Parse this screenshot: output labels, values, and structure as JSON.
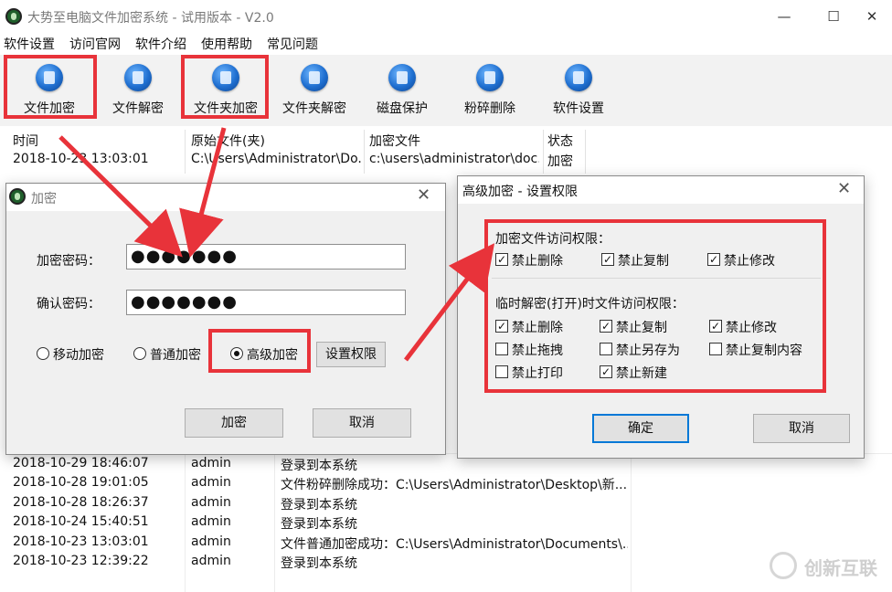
{
  "window": {
    "title": "大势至电脑文件加密系统 - 试用版本 - V2.0",
    "minimize": "—",
    "maximize": "☐",
    "close": "✕"
  },
  "menu": [
    "软件设置",
    "访问官网",
    "软件介绍",
    "使用帮助",
    "常见问题"
  ],
  "toolbar": [
    {
      "label": "文件加密",
      "icon": "file-lock-icon"
    },
    {
      "label": "文件解密",
      "icon": "file-unlock-icon"
    },
    {
      "label": "文件夹加密",
      "icon": "folder-lock-icon"
    },
    {
      "label": "文件夹解密",
      "icon": "folder-unlock-icon"
    },
    {
      "label": "磁盘保护",
      "icon": "disk-shield-icon"
    },
    {
      "label": "粉碎删除",
      "icon": "shred-icon"
    },
    {
      "label": "软件设置",
      "icon": "gear-icon"
    }
  ],
  "table": {
    "columns": [
      "时间",
      "原始文件(夹)",
      "加密文件",
      "状态"
    ],
    "rows": [
      {
        "time": "2018-10-23 13:03:01",
        "original": "C:\\Users\\Administrator\\Do...",
        "encrypted": "c:\\users\\administrator\\doc...",
        "status": "加密"
      }
    ]
  },
  "log": {
    "rows": [
      {
        "time": "2018-10-29 18:46:07",
        "user": "admin",
        "event": "登录到本系统"
      },
      {
        "time": "2018-10-28 19:01:05",
        "user": "admin",
        "event": "文件粉碎删除成功：C:\\Users\\Administrator\\Desktop\\新..."
      },
      {
        "time": "2018-10-28 18:26:37",
        "user": "admin",
        "event": "登录到本系统"
      },
      {
        "time": "2018-10-24 15:40:51",
        "user": "admin",
        "event": "登录到本系统"
      },
      {
        "time": "2018-10-23 13:03:01",
        "user": "admin",
        "event": "文件普通加密成功：C:\\Users\\Administrator\\Documents\\..."
      },
      {
        "time": "2018-10-23 12:39:22",
        "user": "admin",
        "event": "登录到本系统"
      }
    ]
  },
  "encrypt_dialog": {
    "title": "加密",
    "password_label": "加密密码：",
    "password_value": "●●●●●●●",
    "confirm_label": "确认密码：",
    "confirm_value": "●●●●●●●",
    "modes": [
      {
        "label": "移动加密",
        "checked": false
      },
      {
        "label": "普通加密",
        "checked": false
      },
      {
        "label": "高级加密",
        "checked": true
      }
    ],
    "permissions_button": "设置权限",
    "ok_button": "加密",
    "cancel_button": "取消"
  },
  "permission_dialog": {
    "title": "高级加密 - 设置权限",
    "section1_title": "加密文件访问权限：",
    "section1_items": [
      {
        "label": "禁止删除",
        "checked": true
      },
      {
        "label": "禁止复制",
        "checked": true
      },
      {
        "label": "禁止修改",
        "checked": true
      }
    ],
    "section2_title": "临时解密(打开)时文件访问权限：",
    "section2_items": [
      {
        "label": "禁止删除",
        "checked": true
      },
      {
        "label": "禁止复制",
        "checked": true
      },
      {
        "label": "禁止修改",
        "checked": true
      },
      {
        "label": "禁止拖拽",
        "checked": false
      },
      {
        "label": "禁止另存为",
        "checked": false
      },
      {
        "label": "禁止复制内容",
        "checked": false
      },
      {
        "label": "禁止打印",
        "checked": false
      },
      {
        "label": "禁止新建",
        "checked": true
      }
    ],
    "ok_button": "确定",
    "cancel_button": "取消"
  },
  "watermark": {
    "text": "创新互联"
  },
  "colors": {
    "highlight": "#e8333a",
    "toolbar_bg": "#f2f2f2",
    "dialog_bg": "#f0f0f0"
  }
}
